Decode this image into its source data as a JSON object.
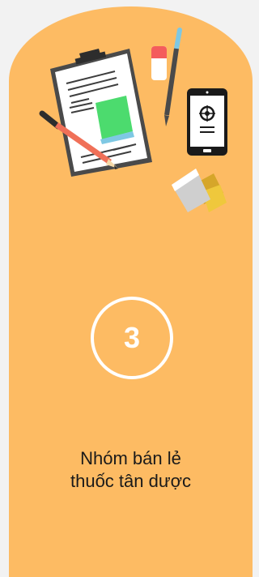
{
  "card": {
    "step_number": "3",
    "title_line1": "Nhóm bán lẻ",
    "title_line2": "thuốc tân dược"
  },
  "colors": {
    "page_background": "#f2f2f2",
    "card_background": "#fdbb63",
    "badge_border": "#ffffff",
    "title_text": "#1a1a1a"
  },
  "icons": [
    "clipboard-icon",
    "pencil-icon",
    "eraser-icon",
    "pen-icon",
    "smartphone-icon",
    "sticky-notes-icon"
  ]
}
